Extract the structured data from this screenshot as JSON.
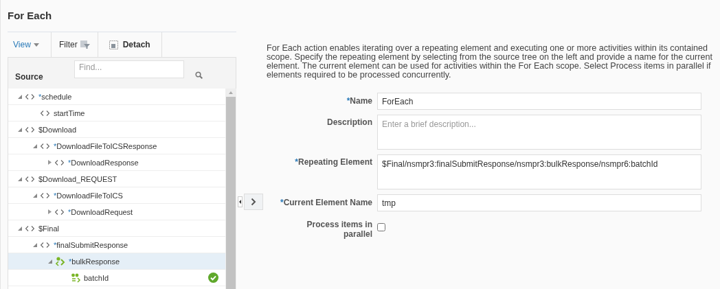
{
  "title": "For Each",
  "toolbar": {
    "view": "View",
    "filter": "Filter",
    "detach": "Detach"
  },
  "source": {
    "label": "Source",
    "find_placeholder": "Find..."
  },
  "tree": [
    {
      "label": "schedule",
      "marker": "*",
      "kind": "element",
      "expanded": true,
      "selected": false,
      "children": [
        {
          "label": "startTime",
          "kind": "element",
          "selected": false
        }
      ]
    },
    {
      "label": "$Download",
      "kind": "element",
      "expanded": true,
      "selected": false,
      "children": [
        {
          "label": "DownloadFileToICSResponse",
          "marker": "*",
          "kind": "element",
          "expanded": true,
          "selected": false,
          "children": [
            {
              "label": "DownloadResponse",
              "marker": "*",
              "kind": "element",
              "expanded": false,
              "selected": false
            }
          ]
        }
      ]
    },
    {
      "label": "$Download_REQUEST",
      "kind": "element",
      "expanded": true,
      "selected": false,
      "children": [
        {
          "label": "DownloadFileToICS",
          "marker": "*",
          "kind": "element",
          "expanded": true,
          "selected": false,
          "children": [
            {
              "label": "DownloadRequest",
              "marker": "*",
              "kind": "element",
              "expanded": false,
              "selected": false
            }
          ]
        }
      ]
    },
    {
      "label": "$Final",
      "kind": "element",
      "expanded": true,
      "selected": false,
      "children": [
        {
          "label": "finalSubmitResponse",
          "marker": "*",
          "kind": "element",
          "expanded": true,
          "selected": false,
          "children": [
            {
              "label": "bulkResponse",
              "marker": "*",
              "kind": "repeating",
              "expanded": true,
              "selected": true,
              "children": [
                {
                  "label": "batchId",
                  "kind": "attribute",
                  "selected": false,
                  "mapped": true
                }
              ]
            }
          ]
        }
      ]
    }
  ],
  "help_text": "For Each action enables iterating over a repeating element and executing one or more activities within its contained scope. Specify the repeating element by selecting from the source tree on the left and provide a name for the current element. The current element can be used for activities within the For Each scope. Select Process items in parallel if elements required to be processed concurrently.",
  "form": [
    {
      "kind": "text",
      "label": "Name",
      "required": true,
      "value": "ForEach"
    },
    {
      "kind": "textarea",
      "label": "Description",
      "required": false,
      "placeholder": "Enter a brief description..."
    },
    {
      "kind": "textarea",
      "label": "Repeating Element",
      "required": true,
      "value": "$Final/nsmpr3:finalSubmitResponse/nsmpr3:bulkResponse/nsmpr6:batchId"
    },
    {
      "kind": "text",
      "label": "Current Element Name",
      "required": true,
      "value": "tmp"
    },
    {
      "kind": "checkbox",
      "label": "Process items in parallel",
      "required": false,
      "checked": false
    }
  ]
}
